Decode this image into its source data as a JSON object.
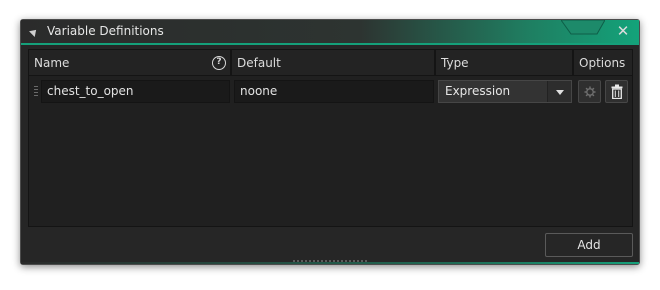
{
  "window": {
    "title": "Variable Definitions"
  },
  "table": {
    "columns": [
      "Name",
      "Default",
      "Type",
      "Options"
    ],
    "rows": [
      {
        "name": "chest_to_open",
        "default": "noone",
        "type": "Expression"
      }
    ]
  },
  "footer": {
    "add_label": "Add"
  },
  "icons": {
    "collapse": "collapse-triangle-icon",
    "close": "close-icon",
    "help": "help-circle-icon",
    "grip": "drag-handle-icon",
    "dropdown": "chevron-down-icon",
    "options": "gear-icon",
    "delete": "trash-icon"
  },
  "colors": {
    "accent": "#15a07a",
    "background": "#262626",
    "panel": "#202020"
  }
}
